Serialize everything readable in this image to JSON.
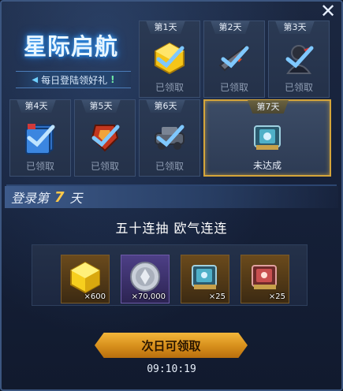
{
  "header": {
    "title": "星际启航",
    "subtitle": "每日登陆领好礼",
    "subtitle_mark": "!",
    "close_label": "✕"
  },
  "days": [
    {
      "label": "第1天",
      "status": "已领取",
      "claimed": true,
      "icon": "gold-cube-icon"
    },
    {
      "label": "第2天",
      "status": "已领取",
      "claimed": true,
      "icon": "weapon-icon"
    },
    {
      "label": "第3天",
      "status": "已领取",
      "claimed": true,
      "icon": "character-icon"
    },
    {
      "label": "第4天",
      "status": "已领取",
      "claimed": true,
      "icon": "card-pack-icon"
    },
    {
      "label": "第5天",
      "status": "已领取",
      "claimed": true,
      "icon": "armor-icon"
    },
    {
      "label": "第6天",
      "status": "已领取",
      "claimed": true,
      "icon": "vehicle-icon"
    },
    {
      "label": "第7天",
      "status": "未达成",
      "claimed": false,
      "icon": "ticket-icon"
    }
  ],
  "login": {
    "prefix": "登录第",
    "day": "7",
    "suffix": "天"
  },
  "reward_title": "五十连抽 欧气连连",
  "rewards": [
    {
      "icon": "gold-cube-icon",
      "count": "×600"
    },
    {
      "icon": "silver-coin-icon",
      "count": "×70,000"
    },
    {
      "icon": "blue-ticket-icon",
      "count": "×25"
    },
    {
      "icon": "red-ticket-icon",
      "count": "×25"
    }
  ],
  "claim_button": "次日可领取",
  "timer": "09:10:19",
  "colors": {
    "accent_gold": "#ffc94a",
    "button": "#e09a24",
    "claimed_text": "#8f9db3",
    "highlight_border": "#d5a53a"
  }
}
